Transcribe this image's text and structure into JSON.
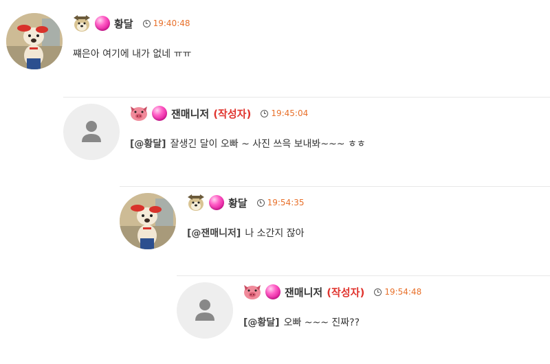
{
  "comments": [
    {
      "nickname": "황달",
      "author_tag": "",
      "time": "19:40:48",
      "mention": "",
      "text": "쨰은아 여기에 내가 없네 ㅠㅠ",
      "avatar": "photo-avatar",
      "level_icon": "dog-level-icon"
    },
    {
      "nickname": "잰매니저",
      "author_tag": "(작성자)",
      "time": "19:45:04",
      "mention": "[@황달]",
      "text": "잘생긴 달이 오빠 ~ 사진 쓰윽 보내봐~~~ ㅎㅎ",
      "avatar": "default-avatar",
      "level_icon": "pig-level-icon"
    },
    {
      "nickname": "황달",
      "author_tag": "",
      "time": "19:54:35",
      "mention": "[@잰매니저]",
      "text": "나 소간지 잖아",
      "avatar": "photo-avatar",
      "level_icon": "dog-level-icon"
    },
    {
      "nickname": "잰매니저",
      "author_tag": "(작성자)",
      "time": "19:54:48",
      "mention": "[@황달]",
      "text": "오빠 ~~~ 진짜??",
      "avatar": "default-avatar",
      "level_icon": "pig-level-icon"
    }
  ],
  "colors": {
    "time": "#e8702a",
    "author_tag": "#e0342e",
    "gem": "#ff5fc6"
  }
}
